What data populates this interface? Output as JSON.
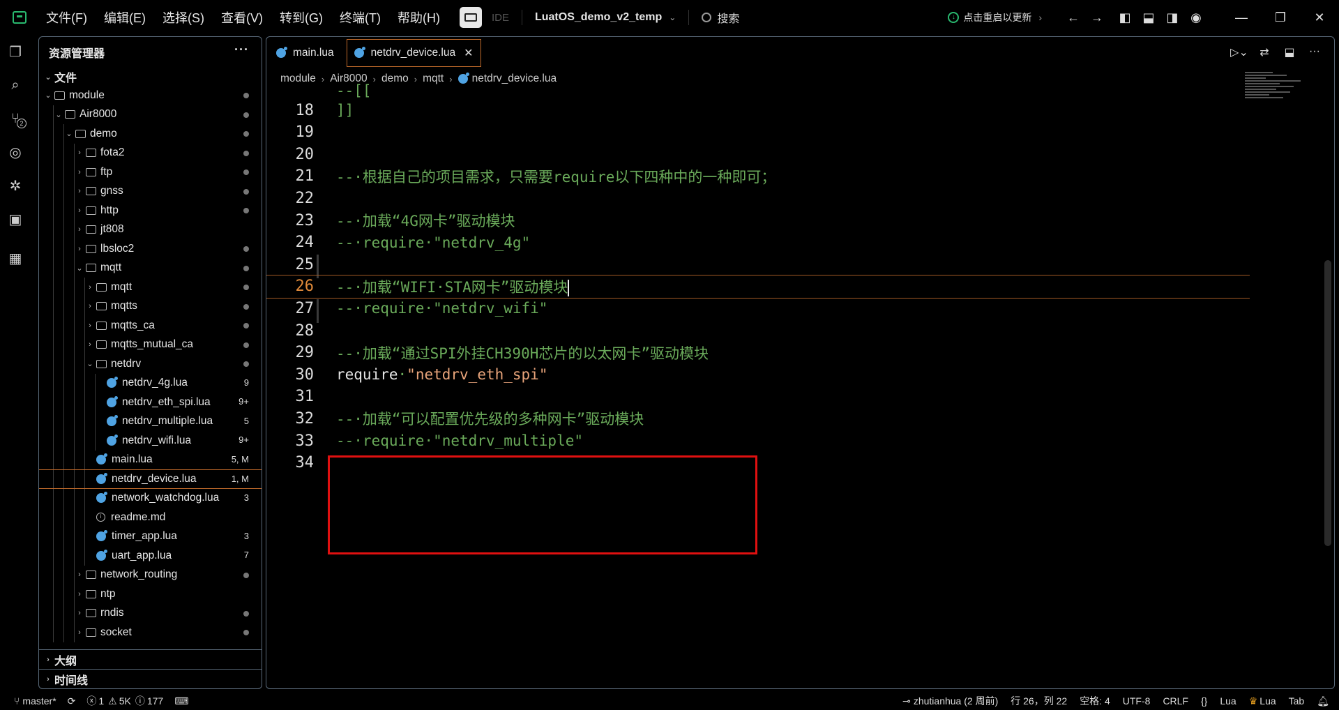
{
  "menu": [
    "文件(F)",
    "编辑(E)",
    "选择(S)",
    "查看(V)",
    "转到(G)",
    "终端(T)",
    "帮助(H)"
  ],
  "ide_label": "IDE",
  "project_name": "LuatOS_demo_v2_temp",
  "search_label": "搜索",
  "update_label": "点击重启以更新",
  "sidebar": {
    "title": "资源管理器",
    "more": "···",
    "section_files": "文件",
    "section_outline": "大纲",
    "section_timeline": "时间线",
    "tree": [
      {
        "label": "module",
        "type": "folder",
        "depth": 0,
        "open": true,
        "dot": true
      },
      {
        "label": "Air8000",
        "type": "folder",
        "depth": 1,
        "open": true,
        "dot": true
      },
      {
        "label": "demo",
        "type": "folder",
        "depth": 2,
        "open": true,
        "dot": true
      },
      {
        "label": "fota2",
        "type": "folder",
        "depth": 3,
        "open": false,
        "dot": true
      },
      {
        "label": "ftp",
        "type": "folder",
        "depth": 3,
        "open": false,
        "dot": true
      },
      {
        "label": "gnss",
        "type": "folder",
        "depth": 3,
        "open": false,
        "dot": true
      },
      {
        "label": "http",
        "type": "folder",
        "depth": 3,
        "open": false,
        "dot": true
      },
      {
        "label": "jt808",
        "type": "folder",
        "depth": 3,
        "open": false,
        "dot": false
      },
      {
        "label": "lbsloc2",
        "type": "folder",
        "depth": 3,
        "open": false,
        "dot": true
      },
      {
        "label": "mqtt",
        "type": "folder",
        "depth": 3,
        "open": true,
        "dot": true
      },
      {
        "label": "mqtt",
        "type": "folder",
        "depth": 4,
        "open": false,
        "dot": true
      },
      {
        "label": "mqtts",
        "type": "folder",
        "depth": 4,
        "open": false,
        "dot": true
      },
      {
        "label": "mqtts_ca",
        "type": "folder",
        "depth": 4,
        "open": false,
        "dot": true
      },
      {
        "label": "mqtts_mutual_ca",
        "type": "folder",
        "depth": 4,
        "open": false,
        "dot": true
      },
      {
        "label": "netdrv",
        "type": "folder",
        "depth": 4,
        "open": true,
        "dot": true
      },
      {
        "label": "netdrv_4g.lua",
        "type": "lua",
        "depth": 5,
        "status": "9"
      },
      {
        "label": "netdrv_eth_spi.lua",
        "type": "lua",
        "depth": 5,
        "status": "9+"
      },
      {
        "label": "netdrv_multiple.lua",
        "type": "lua",
        "depth": 5,
        "status": "5"
      },
      {
        "label": "netdrv_wifi.lua",
        "type": "lua",
        "depth": 5,
        "status": "9+"
      },
      {
        "label": "main.lua",
        "type": "lua",
        "depth": 4,
        "status": "5, M"
      },
      {
        "label": "netdrv_device.lua",
        "type": "lua",
        "depth": 4,
        "status": "1, M",
        "active": true
      },
      {
        "label": "network_watchdog.lua",
        "type": "lua",
        "depth": 4,
        "status": "3"
      },
      {
        "label": "readme.md",
        "type": "info",
        "depth": 4,
        "status": ""
      },
      {
        "label": "timer_app.lua",
        "type": "lua",
        "depth": 4,
        "status": "3"
      },
      {
        "label": "uart_app.lua",
        "type": "lua",
        "depth": 4,
        "status": "7"
      },
      {
        "label": "network_routing",
        "type": "folder",
        "depth": 3,
        "open": false,
        "dot": true
      },
      {
        "label": "ntp",
        "type": "folder",
        "depth": 3,
        "open": false,
        "dot": false
      },
      {
        "label": "rndis",
        "type": "folder",
        "depth": 3,
        "open": false,
        "dot": true
      },
      {
        "label": "socket",
        "type": "folder",
        "depth": 3,
        "open": false,
        "dot": true
      }
    ]
  },
  "tabs": [
    {
      "label": "main.lua",
      "active": false
    },
    {
      "label": "netdrv_device.lua",
      "active": true,
      "close": "✕"
    }
  ],
  "breadcrumbs": [
    "module",
    "Air8000",
    "demo",
    "mqtt",
    "netdrv_device.lua"
  ],
  "code": {
    "sticky": "--[[",
    "lines": [
      {
        "n": "18",
        "parts": [
          {
            "t": "]]",
            "c": "comment"
          }
        ]
      },
      {
        "n": "19",
        "parts": []
      },
      {
        "n": "20",
        "parts": []
      },
      {
        "n": "21",
        "parts": [
          {
            "t": "--·根据自己的项目需求，只需要require以下四种中的一种即可；",
            "c": "comment"
          }
        ]
      },
      {
        "n": "22",
        "parts": []
      },
      {
        "n": "23",
        "parts": [
          {
            "t": "--·加载“4G网卡”驱动模块",
            "c": "comment"
          }
        ]
      },
      {
        "n": "24",
        "parts": [
          {
            "t": "--·require·\"netdrv_4g\"",
            "c": "comment"
          }
        ]
      },
      {
        "n": "25",
        "parts": []
      },
      {
        "n": "26",
        "parts": [
          {
            "t": "--·加载“WIFI·STA网卡”驱动模块",
            "c": "comment"
          }
        ],
        "current": true
      },
      {
        "n": "27",
        "parts": [
          {
            "t": "--·require·\"netdrv_wifi\"",
            "c": "comment"
          }
        ]
      },
      {
        "n": "28",
        "parts": []
      },
      {
        "n": "29",
        "parts": [
          {
            "t": "--·加载“通过SPI外挂CH390H芯片的以太网卡”驱动模块",
            "c": "comment"
          }
        ]
      },
      {
        "n": "30",
        "parts": [
          {
            "t": "require",
            "c": "kw"
          },
          {
            "t": "·",
            "c": "comment"
          },
          {
            "t": "\"netdrv_eth_spi\"",
            "c": "str"
          }
        ]
      },
      {
        "n": "31",
        "parts": []
      },
      {
        "n": "32",
        "parts": [
          {
            "t": "--·加载“可以配置优先级的多种网卡”驱动模块",
            "c": "comment"
          }
        ]
      },
      {
        "n": "33",
        "parts": [
          {
            "t": "--·require·\"netdrv_multiple\"",
            "c": "comment"
          }
        ]
      },
      {
        "n": "34",
        "parts": []
      }
    ]
  },
  "statusbar": {
    "branch": "master*",
    "errors": "1",
    "warnings": "5K",
    "infos": "177",
    "author": "zhutianhua (2 周前)",
    "position": "行 26，列 22",
    "spaces": "空格: 4",
    "encoding": "UTF-8",
    "eol": "CRLF",
    "braces": "{}",
    "language": "Lua",
    "lua_ext": "Lua",
    "tab": "Tab"
  },
  "colors": {
    "accent_orange": "#c06a2b",
    "comment_green": "#6aaa5a",
    "string_orange": "#e8a47a",
    "highlight_red": "#e01010",
    "lua_blue": "#4fa3e3"
  }
}
